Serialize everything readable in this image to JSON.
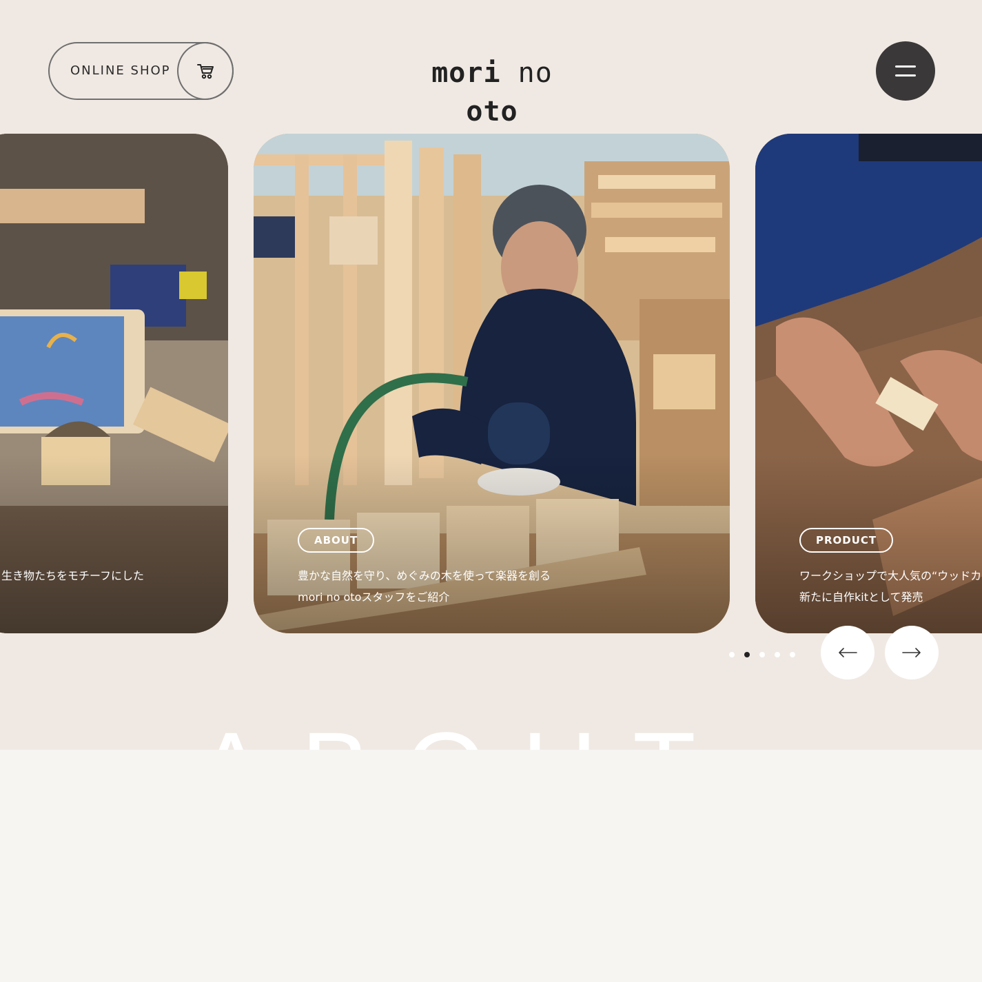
{
  "header": {
    "shop_label": "ONLINE SHOP",
    "cart_icon": "cart-icon",
    "logo_bold1": "mori",
    "logo_light": "no",
    "logo_bold2": "oto",
    "menu_icon": "hamburger-menu-icon"
  },
  "slides": [
    {
      "caption": "生き物たちをモチーフにした"
    },
    {
      "tag": "ABOUT",
      "caption_line1": "豊かな自然を守り、めぐみの木を使って楽器を創る",
      "caption_line2": "mori no otoスタッフをご紹介"
    },
    {
      "tag": "PRODUCT",
      "caption_line1": "ワークショップで大人気の“ウッドカス",
      "caption_line2": "新たに自作kitとして発売"
    }
  ],
  "pager": {
    "dot_count": 5,
    "active_index": 1,
    "prev_icon": "arrow-left-icon",
    "next_icon": "arrow-right-icon"
  },
  "section": {
    "heading": "ABOUT"
  },
  "colors": {
    "top_background": "#f0e9e3",
    "page_background": "#f7f5f2",
    "menu_button": "#3a3838"
  }
}
